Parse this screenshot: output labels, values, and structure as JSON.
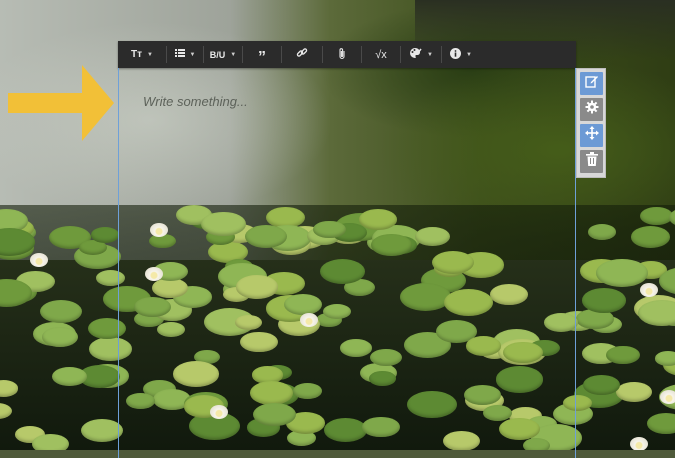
{
  "editor": {
    "placeholder": "Write something..."
  },
  "toolbar": {
    "buttons": [
      {
        "name": "text-size",
        "label": "Tт",
        "dropdown": true
      },
      {
        "name": "list",
        "label": "",
        "dropdown": true
      },
      {
        "name": "text-style",
        "label": "B/U",
        "dropdown": true
      },
      {
        "name": "quote",
        "label": "”",
        "dropdown": false
      },
      {
        "name": "link",
        "label": "",
        "dropdown": false
      },
      {
        "name": "attachment",
        "label": "",
        "dropdown": false
      },
      {
        "name": "formula",
        "label": "√x",
        "dropdown": false
      },
      {
        "name": "color",
        "label": "",
        "dropdown": true
      },
      {
        "name": "info",
        "label": "",
        "dropdown": true
      }
    ]
  },
  "side_tools": [
    "edit-icon",
    "gear-icon",
    "move-icon",
    "trash-icon"
  ],
  "colors": {
    "toolbar_bg": "#2b2b2b",
    "frame_border": "#6ea0d8",
    "side_active": "#6c9ad5",
    "arrow": "#f2c037"
  }
}
